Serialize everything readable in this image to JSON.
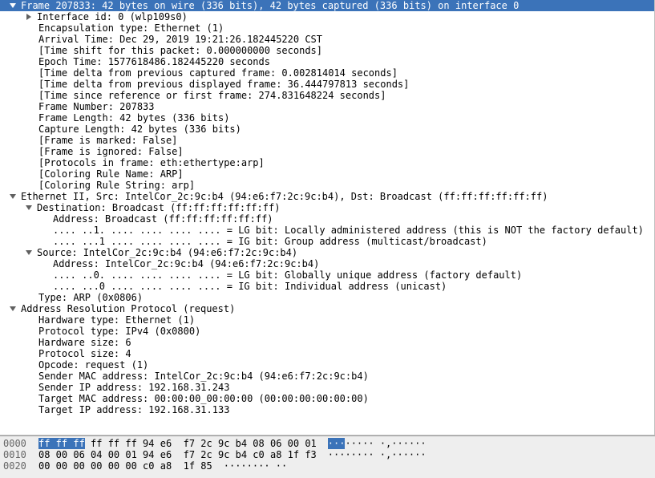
{
  "frame": {
    "header": "Frame 207833: 42 bytes on wire (336 bits), 42 bytes captured (336 bits) on interface 0",
    "interface_id": "Interface id: 0 (wlp109s0)",
    "encapsulation": "Encapsulation type: Ethernet (1)",
    "arrival": "Arrival Time: Dec 29, 2019 19:21:26.182445220 CST",
    "time_shift": "[Time shift for this packet: 0.000000000 seconds]",
    "epoch": "Epoch Time: 1577618486.182445220 seconds",
    "delta_cap": "[Time delta from previous captured frame: 0.002814014 seconds]",
    "delta_disp": "[Time delta from previous displayed frame: 36.444797813 seconds]",
    "since_ref": "[Time since reference or first frame: 274.831648224 seconds]",
    "frame_num": "Frame Number: 207833",
    "frame_len": "Frame Length: 42 bytes (336 bits)",
    "cap_len": "Capture Length: 42 bytes (336 bits)",
    "marked": "[Frame is marked: False]",
    "ignored": "[Frame is ignored: False]",
    "protocols": "[Protocols in frame: eth:ethertype:arp]",
    "color_name": "[Coloring Rule Name: ARP]",
    "color_string": "[Coloring Rule String: arp]"
  },
  "eth": {
    "header": "Ethernet II, Src: IntelCor_2c:9c:b4 (94:e6:f7:2c:9c:b4), Dst: Broadcast (ff:ff:ff:ff:ff:ff)",
    "dst_header": "Destination: Broadcast (ff:ff:ff:ff:ff:ff)",
    "dst_addr": "Address: Broadcast (ff:ff:ff:ff:ff:ff)",
    "dst_lg": ".... ..1. .... .... .... .... = LG bit: Locally administered address (this is NOT the factory default)",
    "dst_ig": ".... ...1 .... .... .... .... = IG bit: Group address (multicast/broadcast)",
    "src_header": "Source: IntelCor_2c:9c:b4 (94:e6:f7:2c:9c:b4)",
    "src_addr": "Address: IntelCor_2c:9c:b4 (94:e6:f7:2c:9c:b4)",
    "src_lg": ".... ..0. .... .... .... .... = LG bit: Globally unique address (factory default)",
    "src_ig": ".... ...0 .... .... .... .... = IG bit: Individual address (unicast)",
    "type": "Type: ARP (0x0806)"
  },
  "arp": {
    "header": "Address Resolution Protocol (request)",
    "hw_type": "Hardware type: Ethernet (1)",
    "proto_type": "Protocol type: IPv4 (0x0800)",
    "hw_size": "Hardware size: 6",
    "proto_size": "Protocol size: 4",
    "opcode": "Opcode: request (1)",
    "sender_mac": "Sender MAC address: IntelCor_2c:9c:b4 (94:e6:f7:2c:9c:b4)",
    "sender_ip": "Sender IP address: 192.168.31.243",
    "target_mac": "Target MAC address: 00:00:00_00:00:00 (00:00:00:00:00:00)",
    "target_ip": "Target IP address: 192.168.31.133"
  },
  "hex": {
    "rows": [
      {
        "offset": "0000",
        "b1": "ff ff ff",
        "b2": " ff ff ff 94 e6  f7 2c 9c b4 08 06 00 01",
        "a1": "···",
        "a2": "····· ·,······"
      },
      {
        "offset": "0010",
        "b1": "",
        "b2": "08 00 06 04 00 01 94 e6  f7 2c 9c b4 c0 a8 1f f3",
        "a1": "",
        "a2": "········ ·,······"
      },
      {
        "offset": "0020",
        "b1": "",
        "b2": "00 00 00 00 00 00 c0 a8  1f 85",
        "a1": "",
        "a2": "········ ··"
      }
    ]
  }
}
